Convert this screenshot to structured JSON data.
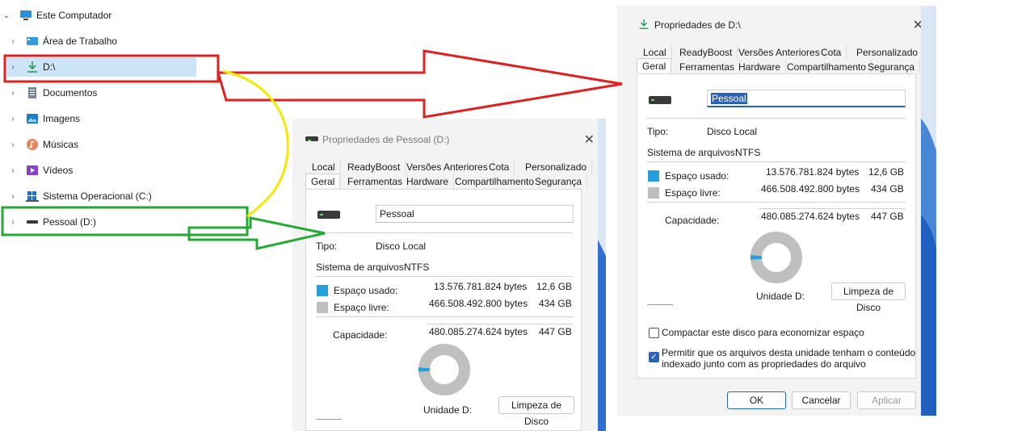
{
  "tree": {
    "root_label": "Este Computador",
    "items": [
      {
        "label": "Área de Trabalho"
      },
      {
        "label": "D:\\"
      },
      {
        "label": "Documentos"
      },
      {
        "label": "Imagens"
      },
      {
        "label": "Músicas"
      },
      {
        "label": "Vídeos"
      },
      {
        "label": "Sistema Operacional (C:)"
      },
      {
        "label": "Pessoal (D:)"
      }
    ]
  },
  "win_small": {
    "title": "Propriedades de Pessoal (D:)",
    "tabs_top": [
      "Local",
      "ReadyBoost",
      "Versões Anteriores",
      "Cota",
      "Personalizado"
    ],
    "tabs_bottom": [
      "Geral",
      "Ferramentas",
      "Hardware",
      "Compartilhamento",
      "Segurança"
    ],
    "name_value": "Pessoal",
    "type_label": "Tipo:",
    "type_value": "Disco Local",
    "fs_label": "Sistema de arquivos:",
    "fs_value": "NTFS",
    "used_label": "Espaço usado:",
    "used_bytes": "13.576.781.824 bytes",
    "used_gb": "12,6 GB",
    "free_label": "Espaço livre:",
    "free_bytes": "466.508.492.800 bytes",
    "free_gb": "434 GB",
    "cap_label": "Capacidade:",
    "cap_bytes": "480.085.274.624 bytes",
    "cap_gb": "447 GB",
    "drive_label": "Unidade D:",
    "cleanup_label": "Limpeza de Disco",
    "used_fraction": 0.028
  },
  "win_large": {
    "title": "Propriedades de D:\\",
    "tabs_top": [
      "Local",
      "ReadyBoost",
      "Versões Anteriores",
      "Cota",
      "Personalizado"
    ],
    "tabs_bottom": [
      "Geral",
      "Ferramentas",
      "Hardware",
      "Compartilhamento",
      "Segurança"
    ],
    "name_value": "Pessoal",
    "type_label": "Tipo:",
    "type_value": "Disco Local",
    "fs_label": "Sistema de arquivos:",
    "fs_value": "NTFS",
    "used_label": "Espaço usado:",
    "used_bytes": "13.576.781.824 bytes",
    "used_gb": "12,6 GB",
    "free_label": "Espaço livre:",
    "free_bytes": "466.508.492.800 bytes",
    "free_gb": "434 GB",
    "cap_label": "Capacidade:",
    "cap_bytes": "480.085.274.624 bytes",
    "cap_gb": "447 GB",
    "drive_label": "Unidade D:",
    "cleanup_label": "Limpeza de Disco",
    "compress_label": "Compactar este disco para economizar espaço",
    "compress_checked": false,
    "index_label_line1": "Permitir que os arquivos desta unidade tenham o conteúdo",
    "index_label_line2": "indexado junto com as propriedades do arquivo",
    "index_checked": true,
    "ok_label": "OK",
    "cancel_label": "Cancelar",
    "apply_label": "Aplicar",
    "used_fraction": 0.028
  },
  "colors": {
    "accent": "#2a62b9",
    "used": "#26a0da",
    "free": "#bfbfbf",
    "red_annotation": "#e02020",
    "green_annotation": "#22aa33",
    "yellow_annotation": "#f2ea00",
    "selection": "#cce4f7"
  }
}
